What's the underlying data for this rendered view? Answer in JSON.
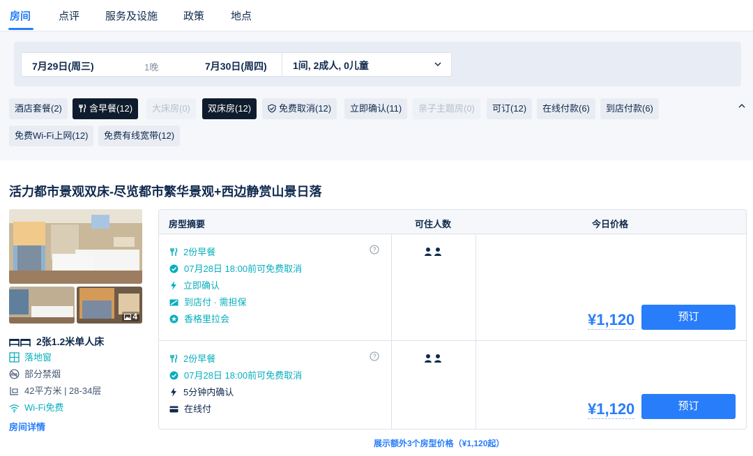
{
  "tabs": [
    {
      "label": "房间"
    },
    {
      "label": "点评"
    },
    {
      "label": "服务及设施"
    },
    {
      "label": "政策"
    },
    {
      "label": "地点"
    }
  ],
  "search": {
    "checkin": "7月29日(周三)",
    "nights": "1晚",
    "checkout": "7月30日(周四)",
    "guests": "1间, 2成人, 0儿童"
  },
  "filters": [
    {
      "label": "酒店套餐(2)"
    },
    {
      "label": "含早餐(12)"
    },
    {
      "label": "大床房(0)"
    },
    {
      "label": "双床房(12)"
    },
    {
      "label": "免费取消(12)"
    },
    {
      "label": "立即确认(11)"
    },
    {
      "label": "亲子主题房(0)"
    },
    {
      "label": "可订(12)"
    },
    {
      "label": "在线付款(6)"
    },
    {
      "label": "到店付款(6)"
    },
    {
      "label": "免费Wi-Fi上网(12)"
    },
    {
      "label": "免费有线宽带(12)"
    }
  ],
  "room": {
    "title": "活力都市景观双床-尽览都市繁华景观+西边静赏山景日落",
    "photo_count": "4",
    "bed": "2张1.2米单人床",
    "window": "落地窗",
    "smoking": "部分禁烟",
    "size": "42平方米 | 28-34层",
    "wifi": "Wi-Fi免费",
    "detail_link": "房间详情"
  },
  "table": {
    "headers": {
      "summary": "房型摘要",
      "occupancy": "可住人数",
      "price": "今日价格"
    },
    "rows": [
      {
        "features": [
          "2份早餐",
          "07月28日 18:00前可免费取消",
          "立即确认",
          "到店付 · 需担保",
          "香格里拉会"
        ],
        "price": "¥1,120",
        "book": "预订"
      },
      {
        "features": [
          "2份早餐",
          "07月28日 18:00前可免费取消",
          "5分钟内确认",
          "在线付"
        ],
        "price": "¥1,120",
        "book": "预订"
      }
    ]
  },
  "more_link": "展示额外3个房型价格（¥1,120起）",
  "colors": {
    "accent": "#287dfa",
    "green": "#06aebd",
    "text": "#0f294d",
    "chip_dark": "#0f1c2e"
  }
}
